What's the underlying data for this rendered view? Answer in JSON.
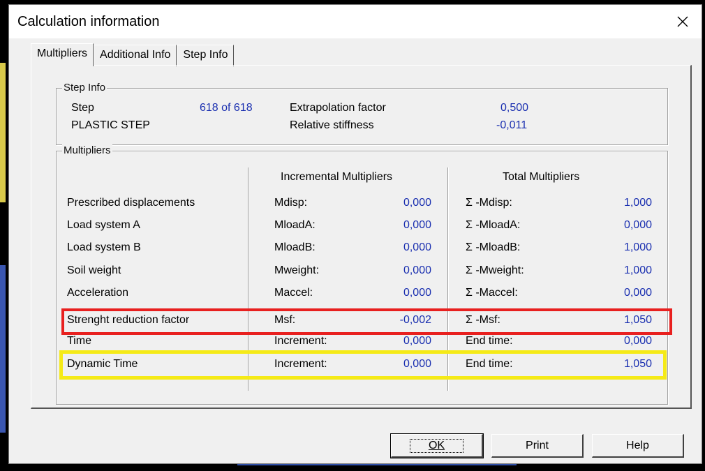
{
  "window": {
    "title": "Calculation information",
    "close_symbol": "✕"
  },
  "tabs": [
    "Multipliers",
    "Additional Info",
    "Step Info"
  ],
  "step_info": {
    "legend": "Step Info",
    "step_label": "Step",
    "step_value": "618 of 618",
    "step_type": "PLASTIC STEP",
    "extrapolation_label": "Extrapolation factor",
    "extrapolation_value": "0,500",
    "stiffness_label": "Relative stiffness",
    "stiffness_value": "-0,011"
  },
  "multipliers": {
    "legend": "Multipliers",
    "incremental_header": "Incremental Multipliers",
    "total_header": "Total Multipliers",
    "rows": [
      {
        "label": "Prescribed displacements",
        "inc_name": "Mdisp:",
        "inc_value": "0,000",
        "tot_name": "Σ -Mdisp:",
        "tot_value": "1,000"
      },
      {
        "label": "Load system A",
        "inc_name": "MloadA:",
        "inc_value": "0,000",
        "tot_name": "Σ -MloadA:",
        "tot_value": "0,000"
      },
      {
        "label": "Load system B",
        "inc_name": "MloadB:",
        "inc_value": "0,000",
        "tot_name": "Σ -MloadB:",
        "tot_value": "1,000"
      },
      {
        "label": "Soil weight",
        "inc_name": "Mweight:",
        "inc_value": "0,000",
        "tot_name": "Σ -Mweight:",
        "tot_value": "1,000"
      },
      {
        "label": "Acceleration",
        "inc_name": "Maccel:",
        "inc_value": "0,000",
        "tot_name": "Σ -Maccel:",
        "tot_value": "0,000"
      },
      {
        "label": "Strenght reduction factor",
        "inc_name": "Msf:",
        "inc_value": "-0,002",
        "tot_name": "Σ -Msf:",
        "tot_value": "1,050"
      },
      {
        "label": "Time",
        "inc_name": "Increment:",
        "inc_value": "0,000",
        "tot_name": "End time:",
        "tot_value": "0,000"
      },
      {
        "label": "Dynamic Time",
        "inc_name": "Increment:",
        "inc_value": "0,000",
        "tot_name": "End time:",
        "tot_value": "1,050"
      }
    ]
  },
  "buttons": {
    "ok": "OK",
    "print": "Print",
    "help": "Help"
  },
  "colors": {
    "highlight_red": "#e8201f",
    "highlight_yellow": "#f5ea17",
    "value_blue": "#1a2fb0"
  }
}
